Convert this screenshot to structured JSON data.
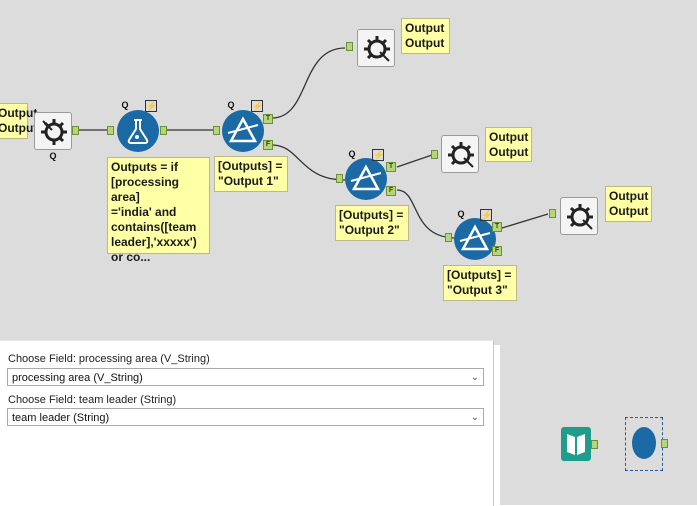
{
  "canvas": {
    "left_note": "Output\nOutput",
    "formula_note": "Outputs = if\n[processing area]\n='india' and\ncontains([team\nleader],'xxxxx')\nor co...",
    "filter1_note": "[Outputs] =\n\"Output 1\"",
    "filter2_note": "[Outputs] =\n\"Output 2\"",
    "filter3_note": "[Outputs] =\n\"Output 3\"",
    "out1_note": "Output\nOutput",
    "out2_note": "Output\nOutput",
    "out3_note": "Output\nOutput",
    "true_anchor": "T",
    "false_anchor": "F",
    "q_badge": "Q",
    "lightning_badge": "⚡"
  },
  "config": {
    "field1_label": "Choose Field: processing area (V_String)",
    "field1_value": "processing area (V_String)",
    "field2_label": "Choose Field: team leader (String)",
    "field2_value": "team leader (String)"
  },
  "colors": {
    "canvas_bg": "#dcdcdc",
    "note_bg": "#ffffa6",
    "tool_blue": "#1b6aa5",
    "anchor_green": "#b7d67a",
    "output_tool_green": "#1e9e8a"
  }
}
